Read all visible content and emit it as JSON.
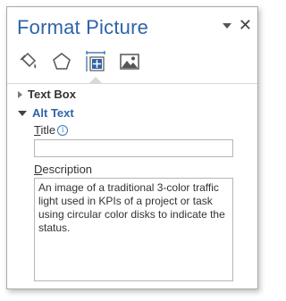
{
  "pane": {
    "title": "Format Picture",
    "tabs": [
      {
        "icon": "fill-bucket-icon"
      },
      {
        "icon": "pentagon-icon"
      },
      {
        "icon": "size-properties-icon",
        "active": true
      },
      {
        "icon": "picture-icon"
      }
    ],
    "sections": {
      "text_box": {
        "label": "Text Box",
        "expanded": false
      },
      "alt_text": {
        "label": "Alt Text",
        "expanded": true
      }
    },
    "alt_text": {
      "title_label_underlined": "T",
      "title_label_rest": "itle",
      "title_value": "",
      "description_label_underlined": "D",
      "description_label_rest": "escription",
      "description_value": "An image of a traditional 3-color traffic light used in KPIs  of a project or task using circular color disks to indicate the status."
    }
  },
  "colors": {
    "accent": "#2e64a8",
    "text": "#333333",
    "border": "#b5b5b5"
  }
}
